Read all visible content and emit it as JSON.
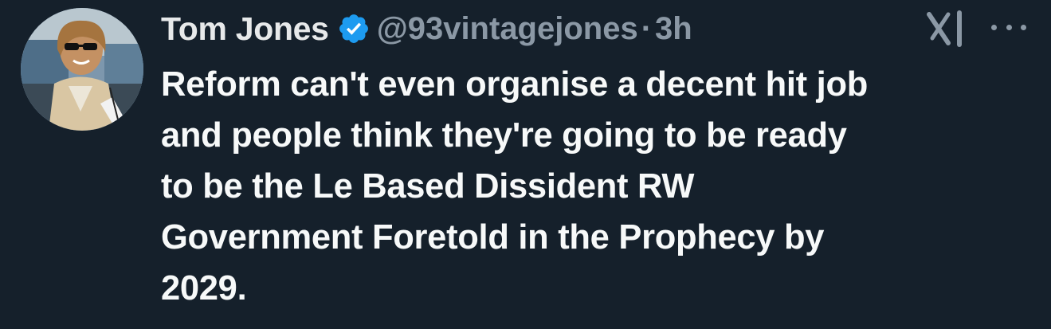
{
  "author": {
    "display_name": "Tom Jones",
    "handle": "@93vintagejones",
    "separator": "·",
    "timestamp": "3h",
    "verified": true
  },
  "tweet": {
    "text": "Reform can't even organise a decent hit job\nand people think they're going to be ready\nto be the Le Based Dissident RW\nGovernment Foretold in the Prophecy by\n2029."
  },
  "icons": {
    "avatar": "profile-photo",
    "verified": "verified-badge-icon",
    "grok": "grok-icon",
    "more": "more-options-icon"
  },
  "colors": {
    "background": "#15202b",
    "text": "#f7f9f9",
    "secondary_text": "#8b98a5",
    "verified_badge": "#1d9bf0"
  }
}
